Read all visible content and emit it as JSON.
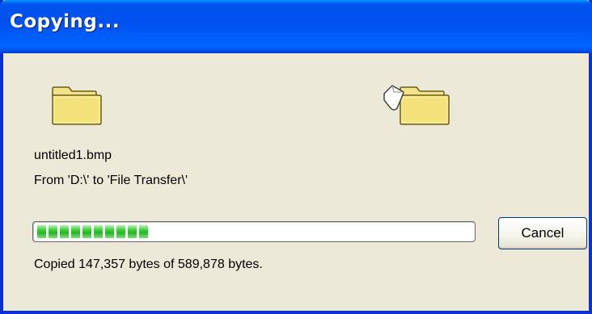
{
  "window": {
    "title": "Copying..."
  },
  "icons": {
    "source": "folder-icon",
    "destination": "folder-with-flying-document-icon"
  },
  "file": {
    "name": "untitled1.bmp",
    "from_to": "From 'D:\\' to 'File Transfer\\'"
  },
  "progress": {
    "fraction": 0.25
  },
  "status": {
    "text": "Copied 147,357 bytes of 589,878 bytes."
  },
  "buttons": {
    "cancel_label": "Cancel"
  },
  "colors": {
    "titlebar": "#0053ee",
    "dialog_background": "#ece9d8",
    "progress_segment": "#33cc33",
    "folder": "#f5e788"
  }
}
